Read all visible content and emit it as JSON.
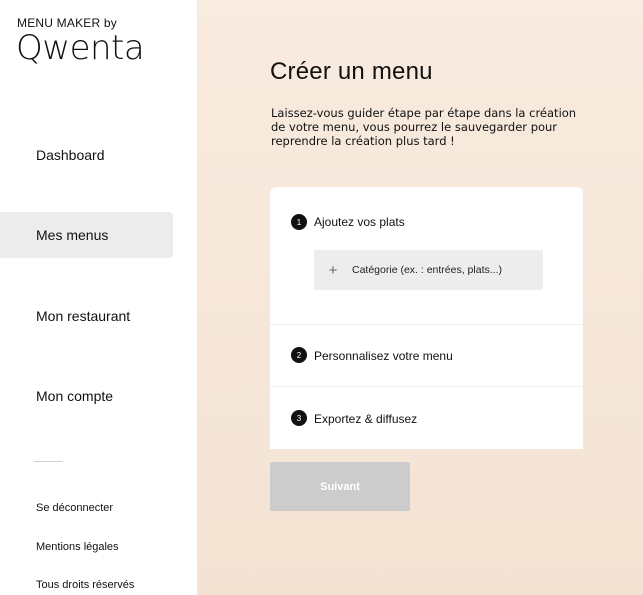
{
  "brand": {
    "top_label": "MENU MAKER by",
    "logo_text": "Qwenta"
  },
  "sidebar": {
    "items": [
      {
        "label": "Dashboard",
        "active": false
      },
      {
        "label": "Mes menus",
        "active": true
      },
      {
        "label": "Mon restaurant",
        "active": false
      },
      {
        "label": "Mon compte",
        "active": false
      }
    ],
    "footer": {
      "logout": "Se déconnecter",
      "legal": "Mentions légales",
      "rights": "Tous droits réservés"
    }
  },
  "main": {
    "title": "Créer un menu",
    "intro": "Laissez-vous guider étape par étape dans la création de votre menu, vous pourrez le sauvegarder pour reprendre la création plus tard !",
    "steps": [
      {
        "number": "1",
        "label": "Ajoutez vos plats"
      },
      {
        "number": "2",
        "label": "Personnalisez votre menu"
      },
      {
        "number": "3",
        "label": "Exportez & diffusez"
      }
    ],
    "category_field": {
      "placeholder": "Catégorie (ex. : entrées, plats...)",
      "icon": "plus-icon"
    },
    "next_button": "Suivant"
  },
  "colors": {
    "background_gradient_start": "#f8ebdf",
    "background_gradient_end": "#f3e3d3",
    "active_nav": "#ececec",
    "disabled_button": "#cccccc",
    "step_badge": "#111111"
  }
}
